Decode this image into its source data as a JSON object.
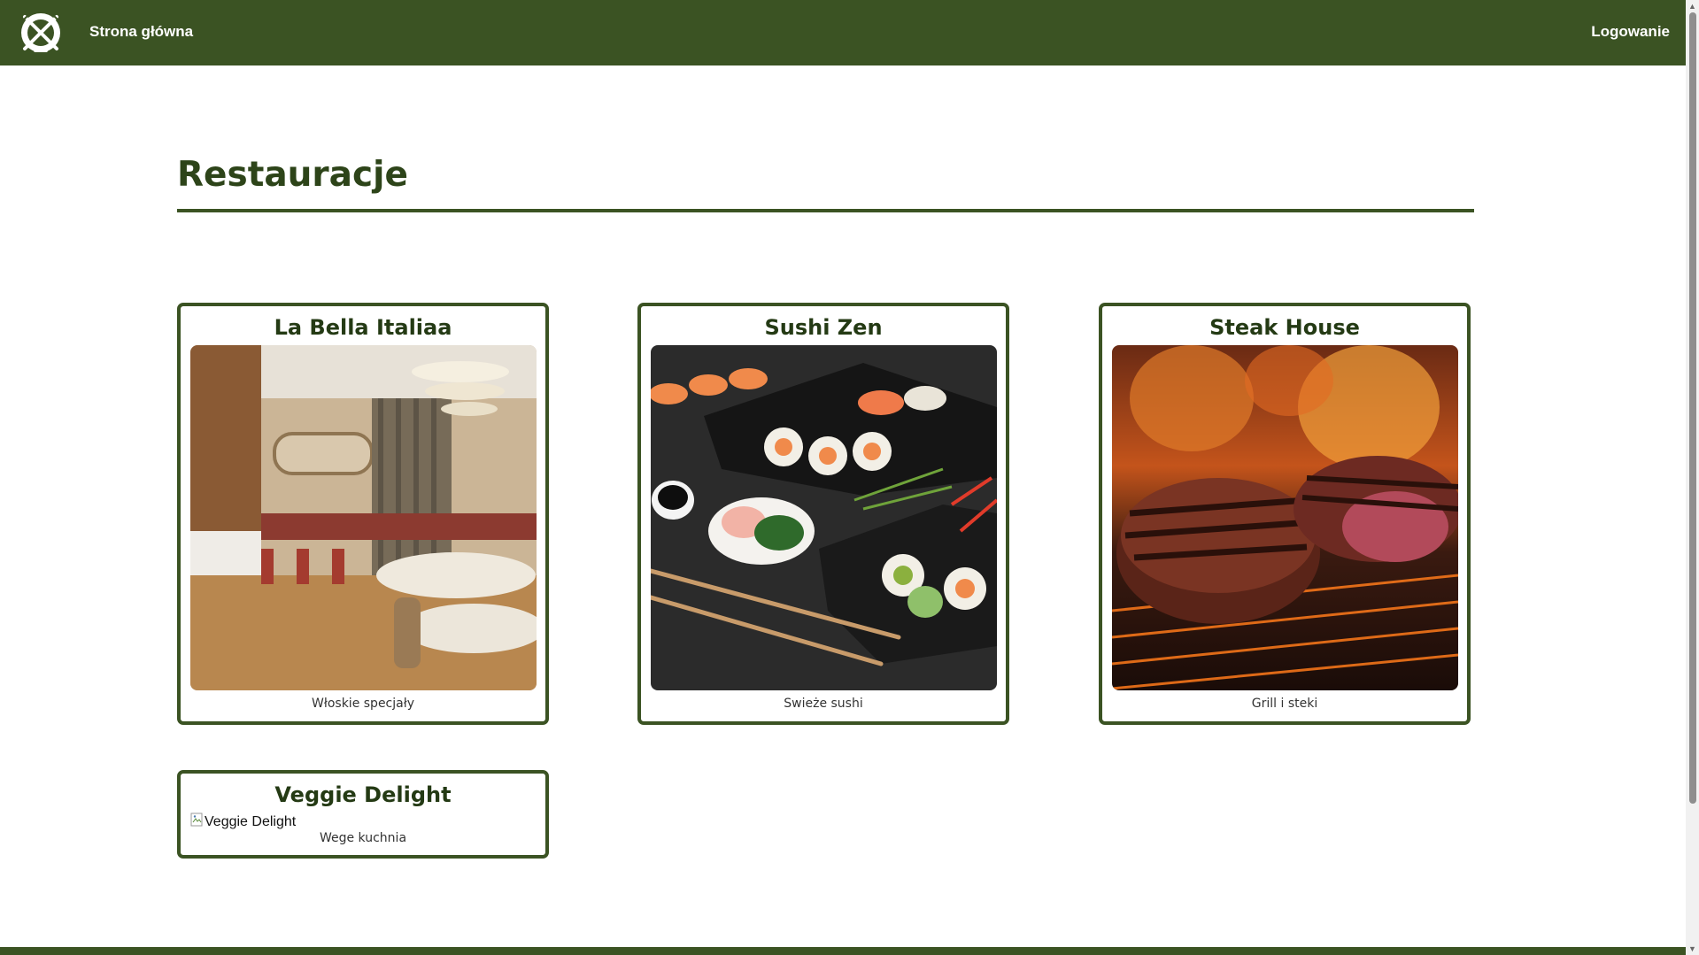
{
  "nav": {
    "home_label": "Strona główna",
    "login_label": "Logowanie"
  },
  "page": {
    "title": "Restauracje"
  },
  "restaurants": [
    {
      "name": "La Bella Italiaa",
      "description": "Włoskie specjały",
      "image_alt": "La Bella Italiaa"
    },
    {
      "name": "Sushi Zen",
      "description": "Swieże sushi",
      "image_alt": "Sushi Zen"
    },
    {
      "name": "Steak House",
      "description": "Grill i steki",
      "image_alt": "Steak House"
    },
    {
      "name": "Veggie Delight",
      "description": "Wege kuchnia",
      "image_alt": "Veggie Delight"
    }
  ],
  "colors": {
    "brand_green": "#3b5323",
    "title_green": "#2d4419",
    "background": "#ffffff"
  },
  "icons": {
    "logo": "crossed-utensils-logo-icon",
    "broken_image": "broken-image-icon"
  }
}
